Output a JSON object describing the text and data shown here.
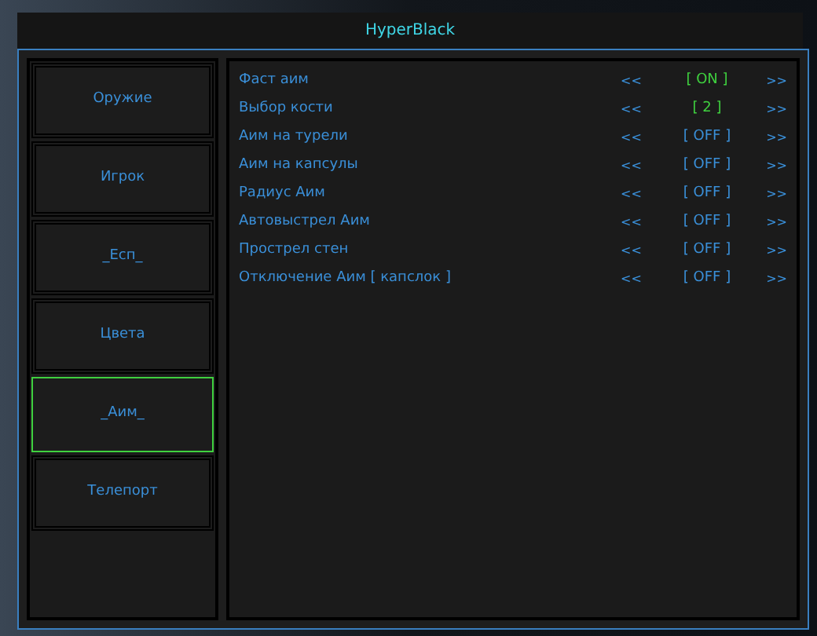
{
  "window": {
    "title": "HyperBlack"
  },
  "tabs": [
    {
      "label": "Оружие",
      "selected": false
    },
    {
      "label": "Игрок",
      "selected": false
    },
    {
      "label": "_Есп_",
      "selected": false
    },
    {
      "label": "Цвета",
      "selected": false
    },
    {
      "label": "_Аим_",
      "selected": true
    },
    {
      "label": "Телепорт",
      "selected": false
    }
  ],
  "options": [
    {
      "label": "Фаст аим",
      "prev": "<<",
      "value": "[ ON ]",
      "on": true,
      "next": ">>"
    },
    {
      "label": "Выбор кости",
      "prev": "<<",
      "value": "[ 2 ]",
      "on": true,
      "next": ">>"
    },
    {
      "label": "Аим на турели",
      "prev": "<<",
      "value": "[ OFF ]",
      "on": false,
      "next": ">>"
    },
    {
      "label": "Аим на капсулы",
      "prev": "<<",
      "value": "[ OFF ]",
      "on": false,
      "next": ">>"
    },
    {
      "label": "Радиус Аим",
      "prev": "<<",
      "value": "[ OFF ]",
      "on": false,
      "next": ">>"
    },
    {
      "label": "Автовыстрел Аим",
      "prev": "<<",
      "value": "[ OFF ]",
      "on": false,
      "next": ">>"
    },
    {
      "label": "Прострел стен",
      "prev": "<<",
      "value": "[ OFF ]",
      "on": false,
      "next": ">>"
    },
    {
      "label": "Отключение Аим [ капслок ]",
      "prev": "<<",
      "value": "[ OFF ]",
      "on": false,
      "next": ">>"
    }
  ]
}
